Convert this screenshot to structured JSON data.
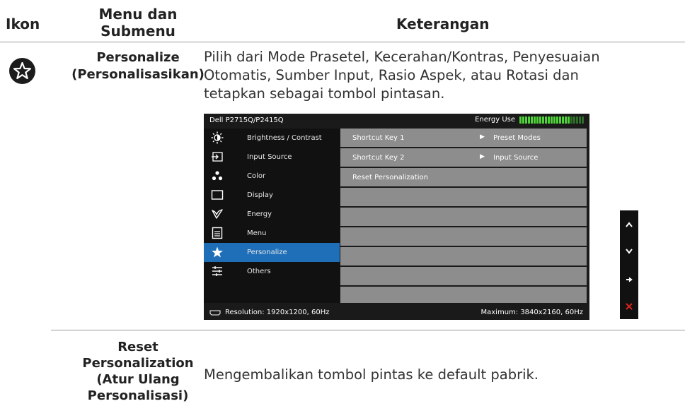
{
  "table_header": {
    "col1": "Ikon",
    "col2_line1": "Menu dan",
    "col2_line2": "Submenu",
    "col3": "Keterangan"
  },
  "rows": [
    {
      "icon": "star-icon",
      "title_line1": "Personalize",
      "title_line2": "(Personalisasikan)",
      "desc_line1": "Pilih dari Mode Prasetel, Kecerahan/Kontras, Penyesuaian",
      "desc_line2": "Otomatis, Sumber Input, Rasio Aspek, atau Rotasi dan",
      "desc_line3": "tetapkan sebagai tombol pintasan."
    },
    {
      "title_line1": "Reset",
      "title_line2": "Personalization",
      "title_line3": "(Atur Ulang",
      "title_line4": "Personalisasi)",
      "desc_line1": "Mengembalikan tombol pintas ke default pabrik."
    }
  ],
  "osd": {
    "model": "Dell P2715Q/P2415Q",
    "energy_label": "Energy Use",
    "energy_level": 0.78,
    "menu": [
      {
        "label": "Brightness / Contrast",
        "icon": "sun-icon"
      },
      {
        "label": "Input Source",
        "icon": "input-icon"
      },
      {
        "label": "Color",
        "icon": "color-dots-icon"
      },
      {
        "label": "Display",
        "icon": "display-icon"
      },
      {
        "label": "Energy",
        "icon": "leaf-icon"
      },
      {
        "label": "Menu",
        "icon": "menu-icon"
      },
      {
        "label": "Personalize",
        "icon": "star-icon",
        "active": true
      },
      {
        "label": "Others",
        "icon": "sliders-icon"
      }
    ],
    "submenu": [
      {
        "key": "Shortcut Key 1",
        "value": "Preset Modes"
      },
      {
        "key": "Shortcut Key 2",
        "value": "Input Source"
      },
      {
        "key": "Reset Personalization",
        "value": ""
      }
    ],
    "resolution": "Resolution: 1920x1200, 60Hz",
    "maximum": "Maximum: 3840x2160, 60Hz",
    "colors": {
      "active": "#1e6fb8",
      "row": "#8d8d8d",
      "bar_on": "#4fd23a"
    }
  },
  "side_buttons": [
    "up-icon",
    "down-icon",
    "right-arrow-icon",
    "close-icon"
  ]
}
